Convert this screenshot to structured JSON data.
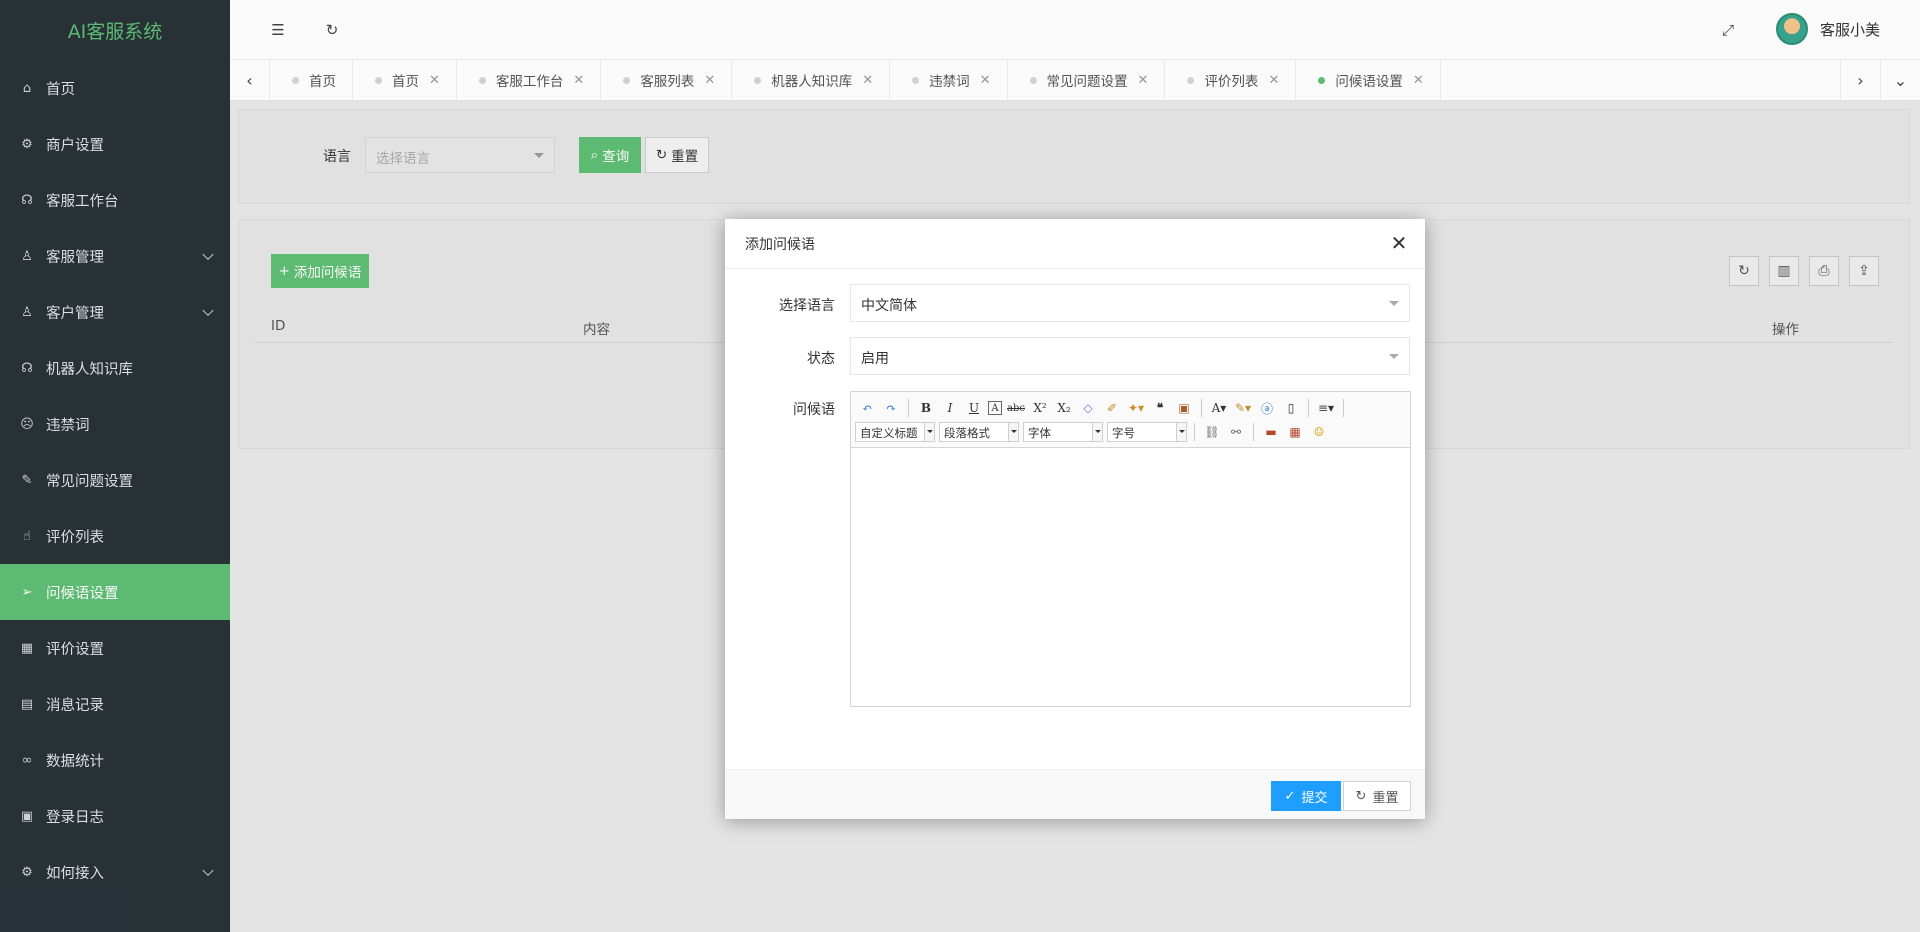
{
  "app": {
    "title": "AI客服系统"
  },
  "sidebar": {
    "items": [
      {
        "label": "首页",
        "icon": "home-icon",
        "glyph": "⌂"
      },
      {
        "label": "商户设置",
        "icon": "gear-icon",
        "glyph": "⚙"
      },
      {
        "label": "客服工作台",
        "icon": "headset-icon",
        "glyph": "☊"
      },
      {
        "label": "客服管理",
        "icon": "user-icon",
        "glyph": "♙"
      },
      {
        "label": "客户管理",
        "icon": "customer-icon",
        "glyph": "♙"
      },
      {
        "label": "机器人知识库",
        "icon": "robot-icon",
        "glyph": "☊"
      },
      {
        "label": "违禁词",
        "icon": "sad-face-icon",
        "glyph": "☹"
      },
      {
        "label": "常见问题设置",
        "icon": "question-icon",
        "glyph": "✎"
      },
      {
        "label": "评价列表",
        "icon": "thumbs-up-icon",
        "glyph": "☝"
      },
      {
        "label": "问候语设置",
        "icon": "send-icon",
        "glyph": "➢"
      },
      {
        "label": "评价设置",
        "icon": "calendar-icon",
        "glyph": "▦"
      },
      {
        "label": "消息记录",
        "icon": "document-icon",
        "glyph": "▤"
      },
      {
        "label": "数据统计",
        "icon": "link-icon",
        "glyph": "∞"
      },
      {
        "label": "登录日志",
        "icon": "log-icon",
        "glyph": "▣"
      },
      {
        "label": "如何接入",
        "icon": "integrate-icon",
        "glyph": "⚙"
      }
    ]
  },
  "header": {
    "menu_icon": "☰",
    "refresh_icon": "↻",
    "fullscreen_icon": "⤢",
    "globe_icon": "⊕",
    "user_name": "客服小美"
  },
  "tabs": {
    "left_arrow": "‹",
    "right_arrow": "›",
    "dropdown_arrow": "⌄",
    "close": "✕",
    "items": [
      {
        "label": "首页"
      },
      {
        "label": "首页"
      },
      {
        "label": "客服工作台"
      },
      {
        "label": "客服列表"
      },
      {
        "label": "机器人知识库"
      },
      {
        "label": "违禁词"
      },
      {
        "label": "常见问题设置"
      },
      {
        "label": "评价列表"
      },
      {
        "label": "问候语设置"
      }
    ]
  },
  "filter": {
    "language_label": "语言",
    "language_placeholder": "选择语言",
    "query_button": "查询",
    "reset_button": "重置"
  },
  "list": {
    "add_button": "添加问候语",
    "columns": {
      "id": "ID",
      "content": "内容",
      "actions": "操作"
    }
  },
  "modal": {
    "title": "添加问候语",
    "close_glyph": "✕",
    "language_label": "选择语言",
    "language_value": "中文简体",
    "status_label": "状态",
    "status_value": "启用",
    "greeting_label": "问候语",
    "editor": {
      "heading_combo": "自定义标题",
      "paragraph_combo": "段落格式",
      "font_combo": "字体",
      "size_combo": "字号"
    },
    "submit_button": "提交",
    "reset_button": "重置"
  },
  "colors": {
    "accent": "#5fbe75",
    "sidebar": "#283238",
    "submit": "#1e9fff"
  }
}
